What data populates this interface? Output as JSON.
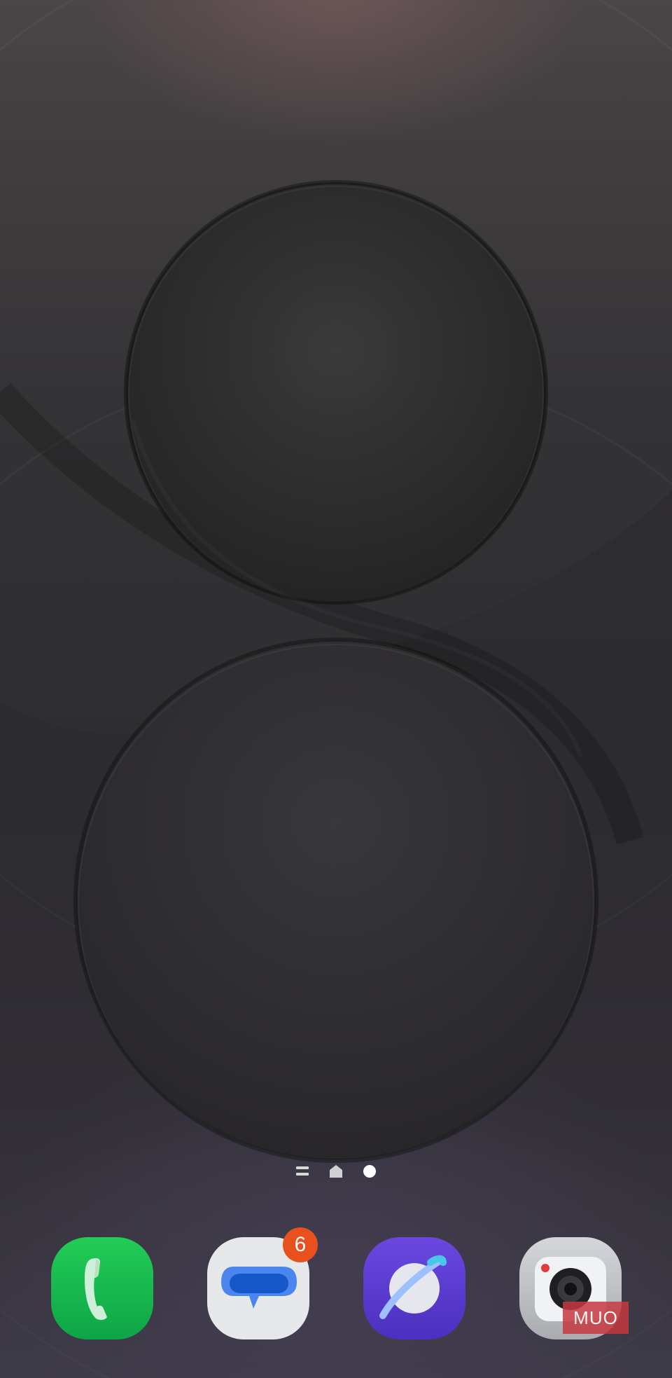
{
  "wallpaper": {
    "name": "s-wallpaper",
    "accent": "#2c2b2d"
  },
  "page_indicator": {
    "items": [
      {
        "type": "apps-list",
        "icon": "list-icon"
      },
      {
        "type": "home",
        "icon": "home-icon"
      },
      {
        "type": "page",
        "icon": "dot-icon",
        "active": true
      }
    ]
  },
  "dock": {
    "apps": [
      {
        "id": "phone",
        "icon": "phone-icon",
        "color": "#1dbf55"
      },
      {
        "id": "messages",
        "icon": "messages-icon",
        "color": "#e6e8ea",
        "badge": "6"
      },
      {
        "id": "internet",
        "icon": "internet-icon",
        "color": "#5b3dd2"
      },
      {
        "id": "camera",
        "icon": "camera-icon",
        "color": "#c7c9cc"
      }
    ]
  },
  "watermark": {
    "text": "MUO",
    "color": "#c43a40"
  }
}
